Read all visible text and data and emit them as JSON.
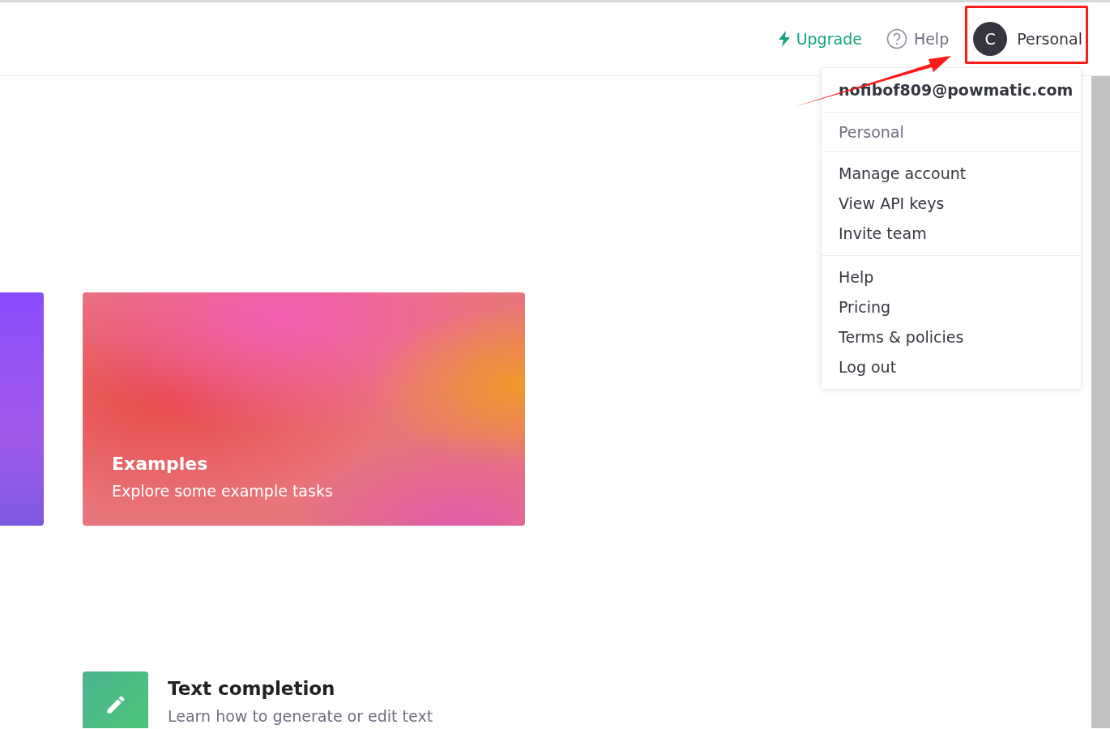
{
  "header": {
    "nav": [
      {
        "kind": "upgrade",
        "label": "Upgrade"
      },
      {
        "kind": "help",
        "label": "Help"
      }
    ],
    "account": {
      "initial": "C",
      "label": "Personal",
      "highlighted": true
    }
  },
  "dropdown": {
    "email": "nofibof809@powmatic.com",
    "organization": "Personal",
    "sections": [
      [
        "Manage account",
        "View API keys",
        "Invite team"
      ],
      [
        "Help",
        "Pricing",
        "Terms & policies",
        "Log out"
      ]
    ]
  },
  "cards": [
    {
      "kind": "partial"
    },
    {
      "kind": "examples",
      "title": "Examples",
      "subtitle": "Explore some example tasks"
    }
  ],
  "guides": [
    {
      "title": "Text completion",
      "subtitle": "Learn how to generate or edit text"
    }
  ]
}
